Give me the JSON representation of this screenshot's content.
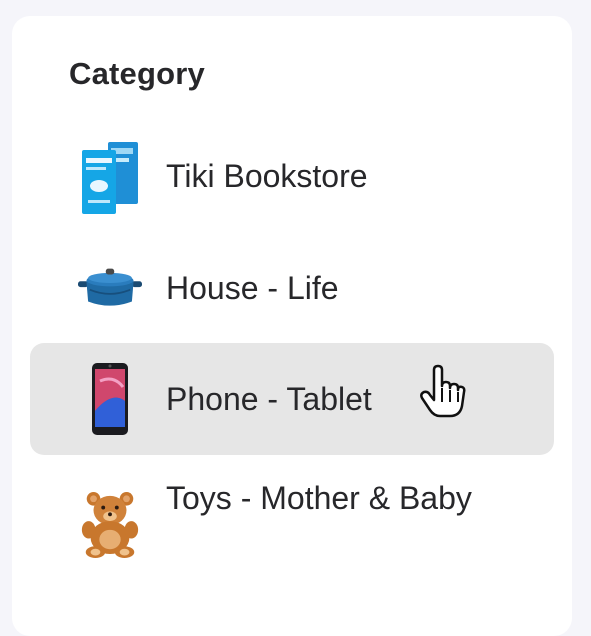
{
  "category": {
    "title": "Category",
    "items": [
      {
        "label": "Tiki Bookstore",
        "icon": "book-icon"
      },
      {
        "label": "House - Life",
        "icon": "pot-icon"
      },
      {
        "label": "Phone - Tablet",
        "icon": "phone-icon",
        "hovered": true
      },
      {
        "label": "Toys - Mother & Baby",
        "icon": "teddy-bear-icon"
      }
    ]
  },
  "colors": {
    "hover_background": "#e6e6e6",
    "text": "#27272a"
  }
}
